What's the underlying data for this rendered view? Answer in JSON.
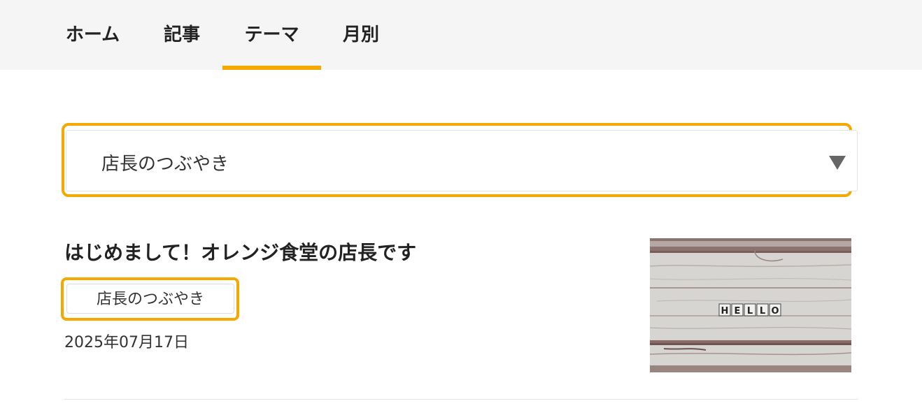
{
  "accent_color": "#f5a800",
  "nav": {
    "tabs": [
      {
        "label": "ホーム",
        "active": false
      },
      {
        "label": "記事",
        "active": false
      },
      {
        "label": "テーマ",
        "active": true
      },
      {
        "label": "月別",
        "active": false
      }
    ]
  },
  "theme_select": {
    "selected": "店長のつぶやき",
    "icon": "triangle-down-icon"
  },
  "article": {
    "title": "はじめまして！オレンジ食堂の店長です",
    "tag": "店長のつぶやき",
    "date": "2025年07月17日",
    "thumbnail_text": "HELLO"
  }
}
